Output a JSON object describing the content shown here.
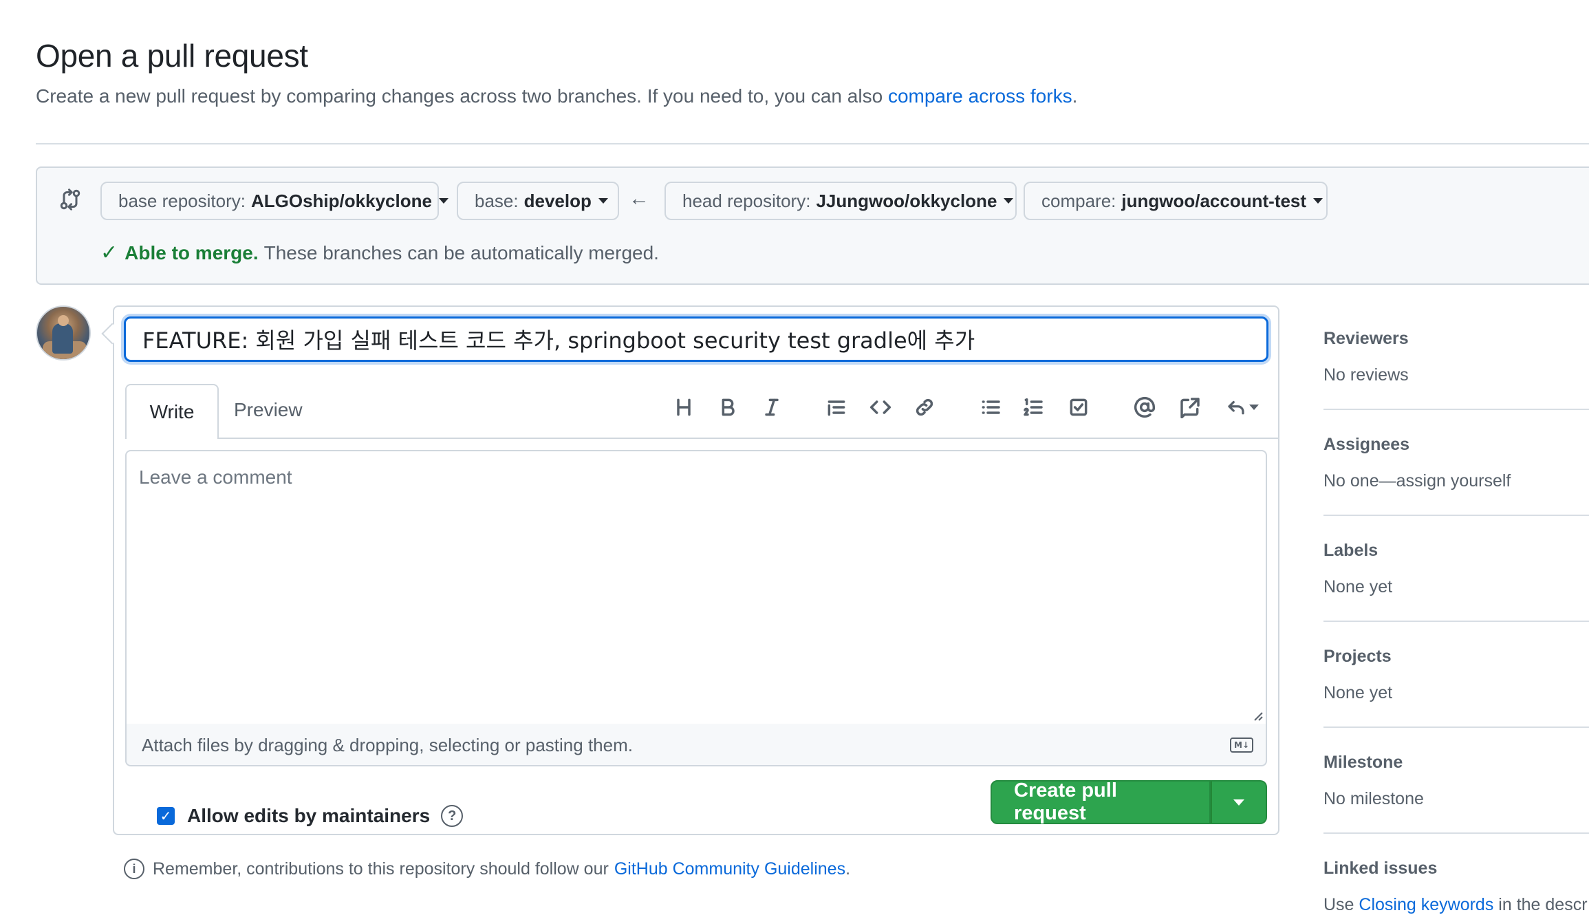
{
  "header": {
    "title": "Open a pull request",
    "subtitle_text": "Create a new pull request by comparing changes across two branches. If you need to, you can also",
    "subtitle_link": "compare across forks",
    "subtitle_end": "."
  },
  "range": {
    "base_repo_label": "base repository:",
    "base_repo_value": "ALGOship/okkyclone",
    "base_label": "base:",
    "base_value": "develop",
    "head_repo_label": "head repository:",
    "head_repo_value": "JJungwoo/okkyclone",
    "compare_label": "compare:",
    "compare_value": "jungwoo/account-test",
    "merge_ok": "Able to merge.",
    "merge_text": "These branches can be automatically merged."
  },
  "form": {
    "title_value": "FEATURE: 회원 가입 실패 테스트 코드 추가, springboot security test gradle에 추가",
    "tab_write": "Write",
    "tab_preview": "Preview",
    "comment_placeholder": "Leave a comment",
    "attach_text": "Attach files by dragging & dropping, selecting or pasting them.",
    "allow_edits_label": "Allow edits by maintainers",
    "create_button": "Create pull request"
  },
  "toolbar": {
    "icons": [
      "heading-icon",
      "bold-icon",
      "italic-icon",
      "quote-icon",
      "code-icon",
      "link-icon",
      "unordered-list-icon",
      "ordered-list-icon",
      "task-list-icon",
      "mention-icon",
      "reference-icon",
      "reply-icon"
    ]
  },
  "guidelines": {
    "text": "Remember, contributions to this repository should follow our",
    "link": "GitHub Community Guidelines",
    "end": "."
  },
  "sidebar": {
    "reviewers_title": "Reviewers",
    "reviewers_value": "No reviews",
    "assignees_title": "Assignees",
    "assignees_value": "No one—assign yourself",
    "labels_title": "Labels",
    "labels_value": "None yet",
    "projects_title": "Projects",
    "projects_value": "None yet",
    "milestone_title": "Milestone",
    "milestone_value": "No milestone",
    "linked_title": "Linked issues",
    "linked_pre": "Use",
    "linked_link": "Closing keywords",
    "linked_post": "in the descr"
  },
  "colors": {
    "link": "#0969da",
    "success": "#1a7f37",
    "button_green": "#2da44e",
    "border": "#d0d7de",
    "muted_text": "#57606a"
  }
}
